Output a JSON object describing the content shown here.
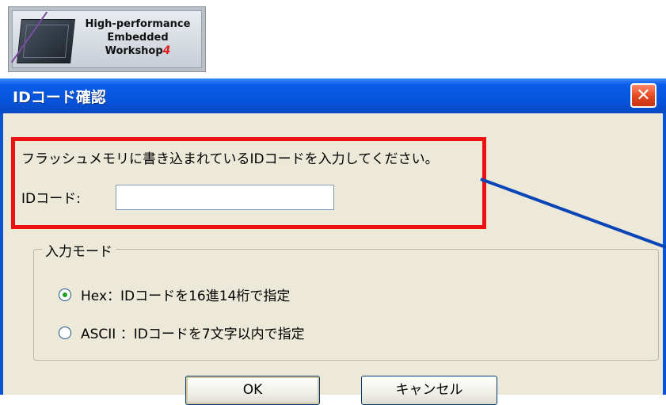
{
  "logo": {
    "line1": "High-performance",
    "line2": "Embedded",
    "line3": "Workshop",
    "superscript": "4"
  },
  "dialog": {
    "title": "IDコード確認",
    "close_glyph": "✕",
    "prompt": "フラッシュメモリに書き込まれているIDコードを入力してください。",
    "id_label": "IDコード:",
    "id_value": "",
    "group_title": "入力モード",
    "radios": [
      {
        "label": "Hex：IDコードを16進14桁で指定",
        "selected": true
      },
      {
        "label": "ASCII ：IDコードを7文字以内で指定",
        "selected": false
      }
    ],
    "ok_label": "OK",
    "cancel_label": "キャンセル"
  },
  "colors": {
    "titlebar": "#0652d8",
    "highlight": "#ee1111",
    "annotation_line": "#0a45b8"
  }
}
